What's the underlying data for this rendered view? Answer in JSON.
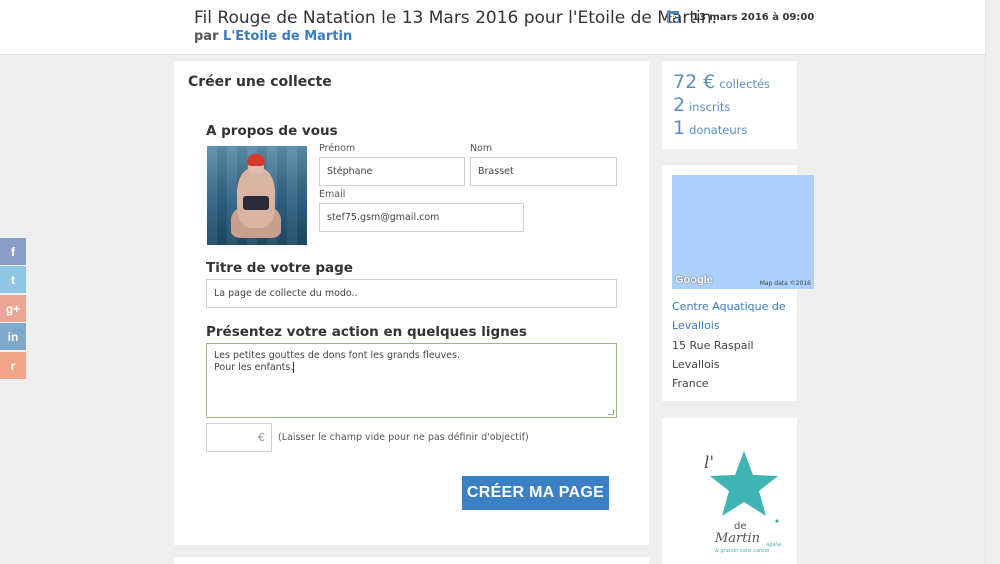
{
  "header": {
    "event_title": "Fil Rouge de Natation le 13 Mars 2016 pour l'Etoile de Martin.",
    "by_prefix": "par",
    "organizer": "L'Etoile de Martin",
    "date": "13 mars 2016 à 09:00",
    "date_icon": "calendar-icon"
  },
  "form": {
    "title": "Créer une collecte",
    "about_heading": "A propos de vous",
    "firstname_label": "Prénom",
    "firstname_value": "Stéphane",
    "lastname_label": "Nom",
    "lastname_value": "Brasset",
    "email_label": "Email",
    "email_value": "stef75.gsm@gmail.com",
    "page_title_heading": "Titre de votre page",
    "page_title_value": "La page de collecte du modo..",
    "description_heading": "Présentez votre action en quelques lignes",
    "description_lines": [
      "Les petites gouttes de dons font les grands fleuves.",
      "Pour les enfants."
    ],
    "amount_currency": "€",
    "amount_hint": "(Laisser le champ vide pour ne pas définir d'objectif)",
    "submit_label": "CRÉER MA PAGE"
  },
  "stats": [
    {
      "number": "72 €",
      "label": "collectés"
    },
    {
      "number": "2",
      "label": "inscrits"
    },
    {
      "number": "1",
      "label": "donateurs"
    }
  ],
  "location": {
    "map_logo": "Google",
    "map_attribution": "Map data ©2016",
    "venue": "Centre Aquatique de Levallois",
    "street": "15 Rue Raspail",
    "city": "Levallois",
    "country": "France"
  },
  "organizer_logo": {
    "text_top": "l'",
    "text_de": "de",
    "text_name": "Martin",
    "tagline_1": "agalia",
    "tagline_2": "& grandir sans cancer",
    "star_color": "#3fb4b2"
  },
  "social": [
    {
      "icon": "facebook-icon",
      "glyph": "f",
      "color": "#8a9fc7"
    },
    {
      "icon": "twitter-icon",
      "glyph": "t",
      "color": "#8fc6e4"
    },
    {
      "icon": "googleplus-icon",
      "glyph": "g+",
      "color": "#e9a596"
    },
    {
      "icon": "linkedin-icon",
      "glyph": "in",
      "color": "#7fa9cb"
    },
    {
      "icon": "reddit-icon",
      "glyph": "r",
      "color": "#f0a488"
    }
  ],
  "colors": {
    "accent": "#3b80c5",
    "link": "#3b7cbf",
    "stat": "#5b8ec2",
    "map_water": "#abd0fb"
  }
}
